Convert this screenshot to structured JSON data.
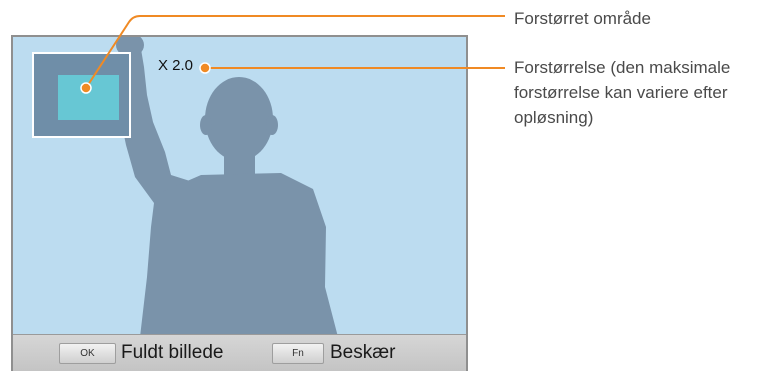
{
  "screen": {
    "zoom_value": "X 2.0"
  },
  "bottom_bar": {
    "ok_key": "OK",
    "ok_label": "Fuldt billede",
    "fn_key": "Fn",
    "fn_label": "Beskær"
  },
  "callouts": {
    "area_label": "Forstørret område",
    "zoom_label": "Forstørrelse (den maksimale forstørrelse kan variere efter opløsning)"
  },
  "colors": {
    "screen_background": "#bcdcf0",
    "silhouette": "#7a93aa",
    "navigator": "#6f8ea8",
    "navigator_area": "#67c7d4",
    "callout_line": "#f08a24"
  }
}
